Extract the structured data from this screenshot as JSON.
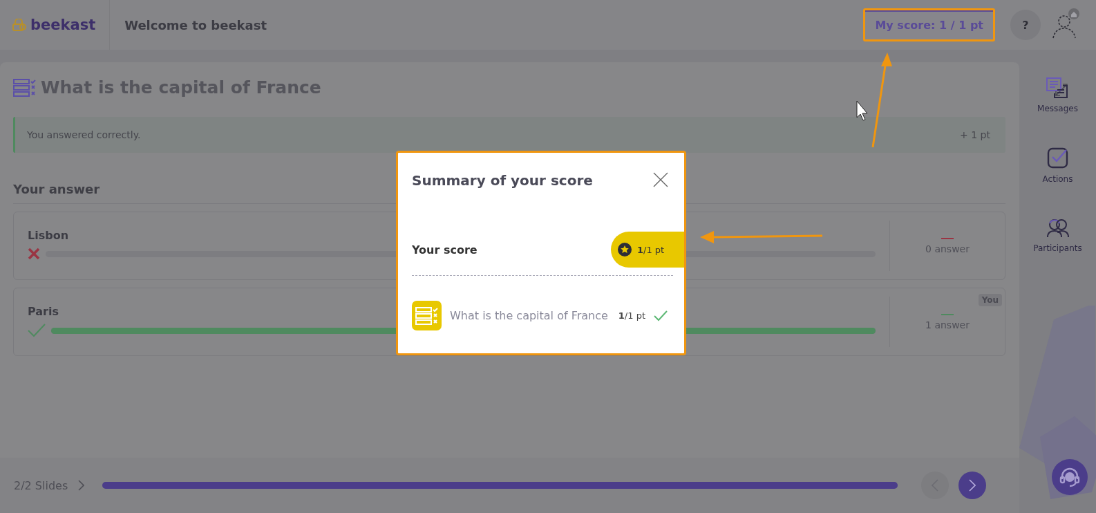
{
  "header": {
    "logo": "beekast",
    "title": "Welcome to beekast",
    "score_button": "My score: 1 / 1 pt",
    "help_button": "?"
  },
  "question": {
    "title": "What is the capital of France",
    "feedback": {
      "message": "You answered correctly.",
      "points": "+ 1 pt"
    },
    "answers_heading": "Your answer",
    "answers": [
      {
        "label": "Lisbon",
        "correct": false,
        "level": 0,
        "count": "0 answer"
      },
      {
        "label": "Paris",
        "correct": true,
        "level": 1,
        "count": "1 answer",
        "badge": "You"
      }
    ]
  },
  "sidebar": {
    "items": [
      {
        "label": "Messages",
        "kind": "messages"
      },
      {
        "label": "Actions",
        "kind": "actions"
      },
      {
        "label": "Participants",
        "kind": "participants"
      }
    ]
  },
  "footer": {
    "slides": "2/2 Slides",
    "level": 1
  },
  "modal": {
    "title": "Summary of your score",
    "score_label": "Your score",
    "score": "**1**/1 pt",
    "items": [
      {
        "title": "What is the capital of France",
        "score": "**1**/1 pt",
        "correct": true
      }
    ]
  }
}
